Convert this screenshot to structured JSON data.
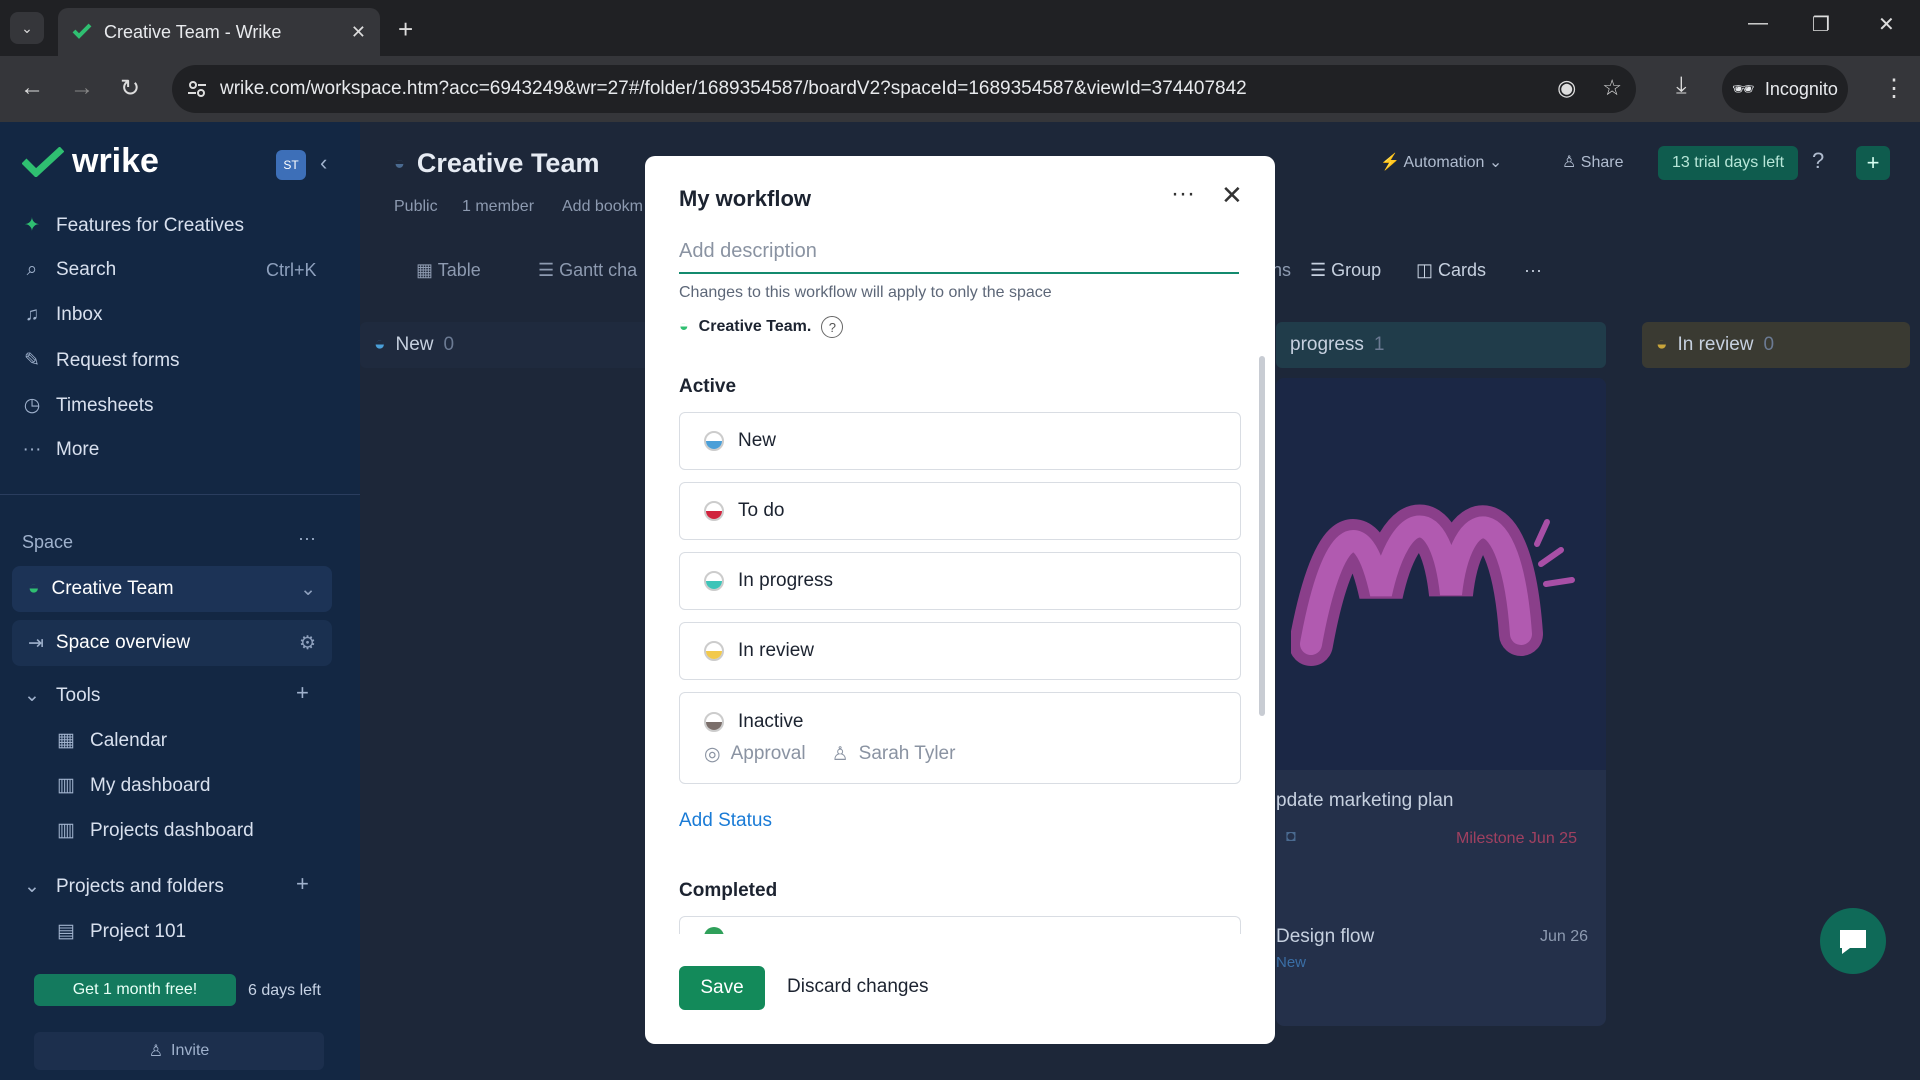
{
  "browser": {
    "tab_title": "Creative Team - Wrike",
    "url": "wrike.com/workspace.htm?acc=6943249&wr=27#/folder/1689354587/boardV2?spaceId=1689354587&viewId=374407842",
    "incognito_label": "Incognito"
  },
  "sidebar": {
    "logo_text": "wrike",
    "avatar_initials": "ST",
    "items": [
      {
        "label": "Features for Creatives",
        "icon": "sparkle-icon"
      },
      {
        "label": "Search",
        "icon": "search-icon",
        "shortcut": "Ctrl+K"
      },
      {
        "label": "Inbox",
        "icon": "bell-icon"
      },
      {
        "label": "Request forms",
        "icon": "form-icon"
      },
      {
        "label": "Timesheets",
        "icon": "clock-icon"
      },
      {
        "label": "More",
        "icon": "dots-icon"
      }
    ],
    "space_label": "Space",
    "space_name": "Creative Team",
    "space_overview": "Space overview",
    "tools_label": "Tools",
    "tools": [
      "Calendar",
      "My dashboard",
      "Projects dashboard"
    ],
    "projects_label": "Projects and folders",
    "projects": [
      "Project 101"
    ],
    "promo_button": "Get 1 month free!",
    "days_left": "6 days left",
    "invite": "Invite"
  },
  "main": {
    "title": "Creative Team",
    "meta": [
      "Public",
      "1 member",
      "Add bookm"
    ],
    "views": [
      "Table",
      "Gantt cha",
      "ns",
      "Group",
      "Cards"
    ],
    "automation": "Automation",
    "share": "Share",
    "trial": "13 trial days left",
    "columns": [
      {
        "label": "New",
        "count": "0"
      },
      {
        "label": "progress",
        "count": "1"
      },
      {
        "label": "In review",
        "count": "0"
      }
    ],
    "card": {
      "title": "pdate marketing plan",
      "milestone": "Milestone Jun 25",
      "subtask": "Design flow",
      "subtask_date": "Jun 26",
      "subtask_status": "New"
    }
  },
  "modal": {
    "title": "My workflow",
    "description_placeholder": "Add description",
    "note": "Changes to this workflow will apply to only the space",
    "space_name": "Creative Team.",
    "active_label": "Active",
    "statuses": [
      {
        "label": "New",
        "color": "#4a9fd8"
      },
      {
        "label": "To do",
        "color": "#d0243e"
      },
      {
        "label": "In progress",
        "color": "#3ec4b8"
      },
      {
        "label": "In review",
        "color": "#f2c94c"
      },
      {
        "label": "Inactive",
        "color": "#7a6e6a"
      }
    ],
    "inactive_approval": "Approval",
    "inactive_assignee": "Sarah Tyler",
    "add_status": "Add Status",
    "completed_label": "Completed",
    "save": "Save",
    "discard": "Discard changes"
  }
}
